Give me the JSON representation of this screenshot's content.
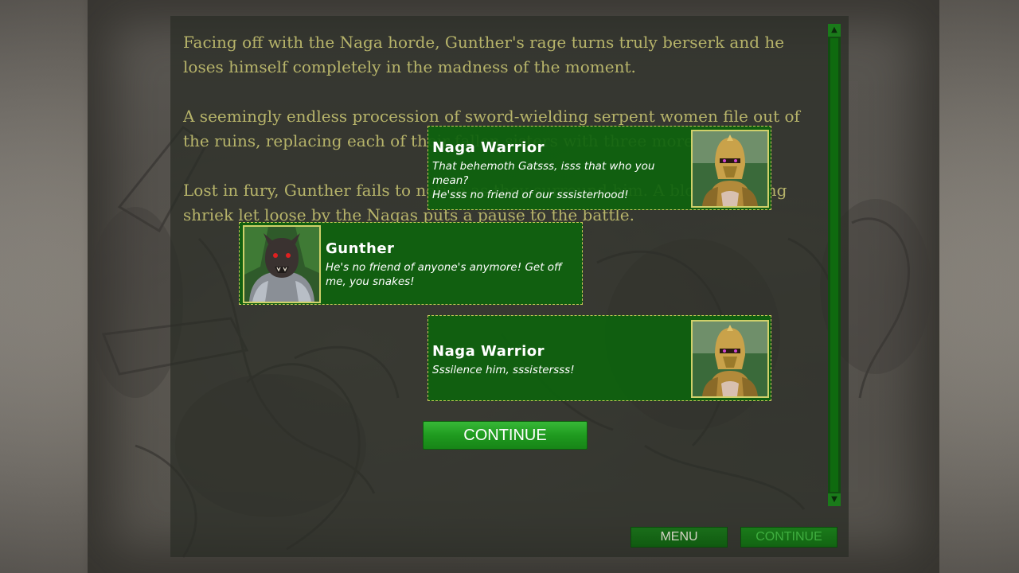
{
  "story": {
    "paragraphs": [
      "Facing off with the Naga horde, Gunther's rage turns truly berserk and he loses himself completely in the madness of the moment.",
      "A seemingly endless procession of sword-wielding serpent women file out of the ruins, replacing each of their fallen sisters with three more.",
      "Lost in fury, Gunther fails to notice as they surround him. A blood curdling shriek let loose by the Nagas puts a pause to the battle."
    ]
  },
  "dialogue": [
    {
      "speaker": "Naga Warrior",
      "lines": [
        "That behemoth Gatsss, isss that who you mean?",
        "He'sss no friend of our sssisterhood!"
      ],
      "portrait": "naga-warrior-portrait"
    },
    {
      "speaker": "Gunther",
      "lines": [
        "He's no friend of anyone's anymore! Get off me, you snakes!"
      ],
      "portrait": "gunther-portrait"
    },
    {
      "speaker": "Naga Warrior",
      "lines": [
        "Sssilence him, sssistersss!"
      ],
      "portrait": "naga-warrior-portrait"
    }
  ],
  "buttons": {
    "continue_main": "CONTINUE",
    "menu": "MENU",
    "continue_small": "CONTINUE"
  },
  "scrollbar": {
    "up_icon": "arrow-up-icon",
    "down_icon": "arrow-down-icon"
  },
  "colors": {
    "story_text": "#b7b46a",
    "bubble_bg": "#0e620e",
    "bubble_border": "#c8c85a",
    "button_green": "#1f9a1f"
  }
}
